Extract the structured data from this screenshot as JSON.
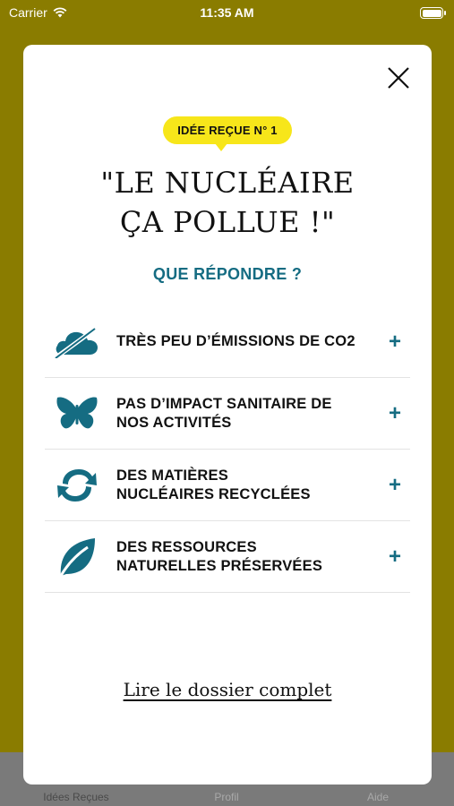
{
  "status_bar": {
    "carrier": "Carrier",
    "time": "11:35 AM"
  },
  "tabs": [
    {
      "label": "Idées Reçues"
    },
    {
      "label": "Profil"
    },
    {
      "label": "Aide"
    }
  ],
  "modal": {
    "badge": "IDÉE REÇUE N° 1",
    "title_line1": "\"LE NUCLÉAIRE",
    "title_line2": "ÇA POLLUE !\"",
    "subtitle": "QUE RÉPONDRE ?",
    "items": [
      {
        "icon": "cloud-no-co2-icon",
        "label": "TRÈS PEU D’ÉMISSIONS DE CO2",
        "action": "+"
      },
      {
        "icon": "butterfly-icon",
        "label": "PAS D’IMPACT SANITAIRE DE\nNOS ACTIVITÉS",
        "action": "+"
      },
      {
        "icon": "recycle-arrows-icon",
        "label": "DES MATIÈRES\nNUCLÉAIRES RECYCLÉES",
        "action": "+"
      },
      {
        "icon": "leaf-icon",
        "label": "DES RESSOURCES\nNATURELLES PRÉSERVÉES",
        "action": "+"
      }
    ],
    "link": "Lire le dossier complet"
  },
  "colors": {
    "accent": "#156c82",
    "badge": "#f7e61a",
    "background": "#8a7c00"
  }
}
